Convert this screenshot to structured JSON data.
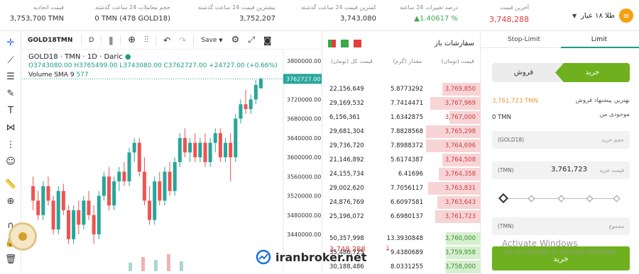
{
  "top_stats": [
    {
      "label": "آخرین قیمت",
      "value": "3,748,288",
      "color": "#e53b3b"
    },
    {
      "label": "درصد تغییرات 24 ساعته",
      "value": "▲1.40617 %",
      "color": "#3aa84b"
    },
    {
      "label": "کمترین قیمت 24 ساعت گذشته",
      "value": "3,743,080",
      "color": "#333333"
    },
    {
      "label": "بیشترین قیمت 24 ساعت گذشته",
      "value": "3,752,207",
      "color": "#333333"
    },
    {
      "label": "حجم معاملات 24 ساعت گذشته",
      "value": "0 TMN (478 GOLD18)",
      "color": "#333333"
    },
    {
      "label": "قیمت اتحادیه",
      "value": "3,753,700 TMN",
      "color": "#333333"
    }
  ],
  "pair": {
    "name": "طلا ۱۸ عیار",
    "icon": "gold-bars-icon"
  },
  "chart_header": {
    "symbol": "GOLD18TMN",
    "interval": "D",
    "save": "Save"
  },
  "legend": {
    "line1": "GOLD18 · TMN · 1D · Daric",
    "ohlc": "O3743080.00 H3765499.00 L3743080.00 C3762727.00 +24727.00 (+0.66%)",
    "volume": "Volume SMA 9",
    "volume_value": "577"
  },
  "chart_data": {
    "type": "candlestick",
    "y_ticks": [
      "3800000.00",
      "3760000.00",
      "3720000.00",
      "3680000.00",
      "3640000.00",
      "3600000.00",
      "3560000.00",
      "3520000.00",
      "3480000.00",
      "3440000.00"
    ],
    "ylim": [
      3400000,
      3820000
    ],
    "last_price_label": "3762727.00",
    "last_price": 3762727,
    "candles": [
      [
        3540000,
        3560000,
        3490000,
        3510000
      ],
      [
        3510000,
        3530000,
        3470000,
        3480000
      ],
      [
        3480000,
        3550000,
        3470000,
        3540000
      ],
      [
        3540000,
        3560000,
        3500000,
        3510000
      ],
      [
        3510000,
        3520000,
        3440000,
        3450000
      ],
      [
        3450000,
        3540000,
        3440000,
        3530000
      ],
      [
        3530000,
        3545000,
        3480000,
        3490000
      ],
      [
        3490000,
        3500000,
        3420000,
        3430000
      ],
      [
        3430000,
        3500000,
        3420000,
        3490000
      ],
      [
        3490000,
        3510000,
        3440000,
        3460000
      ],
      [
        3460000,
        3520000,
        3450000,
        3510000
      ],
      [
        3510000,
        3530000,
        3470000,
        3480000
      ],
      [
        3480000,
        3500000,
        3420000,
        3440000
      ],
      [
        3440000,
        3530000,
        3430000,
        3520000
      ],
      [
        3520000,
        3570000,
        3510000,
        3560000
      ],
      [
        3560000,
        3580000,
        3490000,
        3500000
      ],
      [
        3500000,
        3560000,
        3490000,
        3550000
      ],
      [
        3550000,
        3580000,
        3530000,
        3570000
      ],
      [
        3570000,
        3590000,
        3540000,
        3550000
      ],
      [
        3550000,
        3620000,
        3540000,
        3610000
      ],
      [
        3610000,
        3640000,
        3590000,
        3630000
      ],
      [
        3630000,
        3640000,
        3560000,
        3570000
      ],
      [
        3570000,
        3600000,
        3500000,
        3510000
      ],
      [
        3510000,
        3540000,
        3460000,
        3470000
      ],
      [
        3470000,
        3560000,
        3460000,
        3550000
      ],
      [
        3550000,
        3570000,
        3500000,
        3510000
      ],
      [
        3510000,
        3580000,
        3500000,
        3570000
      ],
      [
        3570000,
        3590000,
        3520000,
        3530000
      ],
      [
        3530000,
        3600000,
        3520000,
        3590000
      ],
      [
        3590000,
        3650000,
        3580000,
        3640000
      ],
      [
        3640000,
        3660000,
        3600000,
        3610000
      ],
      [
        3610000,
        3640000,
        3590000,
        3630000
      ],
      [
        3630000,
        3650000,
        3590000,
        3600000
      ],
      [
        3600000,
        3640000,
        3590000,
        3630000
      ],
      [
        3630000,
        3650000,
        3580000,
        3590000
      ],
      [
        3590000,
        3640000,
        3580000,
        3630000
      ],
      [
        3630000,
        3660000,
        3610000,
        3650000
      ],
      [
        3650000,
        3660000,
        3590000,
        3600000
      ],
      [
        3600000,
        3640000,
        3590000,
        3630000
      ],
      [
        3630000,
        3650000,
        3550000,
        3600000
      ],
      [
        3600000,
        3690000,
        3590000,
        3680000
      ],
      [
        3680000,
        3720000,
        3670000,
        3710000
      ],
      [
        3710000,
        3740000,
        3690000,
        3700000
      ],
      [
        3700000,
        3730000,
        3690000,
        3720000
      ],
      [
        3720000,
        3760000,
        3710000,
        3750000
      ],
      [
        3743080,
        3765499,
        3743080,
        3762727
      ]
    ]
  },
  "order_book": {
    "title": "سفارشات باز",
    "headers": {
      "price": "قیمت (تومان)",
      "amount": "مقدار (گرم)",
      "total": "قیمت کل (تومان)"
    },
    "asks": [
      {
        "price": "3,769,850",
        "amount": "5.8773292",
        "total": "22,156,649",
        "depth": 0.55
      },
      {
        "price": "3,767,969",
        "amount": "7.7414471",
        "total": "29,169,532",
        "depth": 0.72
      },
      {
        "price": "3,767,000",
        "amount": "1.6342875",
        "total": "6,156,361",
        "depth": 0.45
      },
      {
        "price": "3,765,298",
        "amount": "7.8828568",
        "total": "29,681,304",
        "depth": 0.78
      },
      {
        "price": "3,764,696",
        "amount": "7.8988372",
        "total": "29,736,720",
        "depth": 0.78
      },
      {
        "price": "3,764,508",
        "amount": "5.6174387",
        "total": "21,146,892",
        "depth": 0.55
      },
      {
        "price": "3,764,358",
        "amount": "6.41696",
        "total": "24,155,734",
        "depth": 0.6
      },
      {
        "price": "3,763,831",
        "amount": "7.7056117",
        "total": "29,002,620",
        "depth": 0.75
      },
      {
        "price": "3,763,643",
        "amount": "6.6097581",
        "total": "24,876,769",
        "depth": 0.62
      },
      {
        "price": "3,761,723",
        "amount": "6.6980137",
        "total": "25,196,072",
        "depth": 0.65
      }
    ],
    "last_price": "3,748,288",
    "bids": [
      {
        "price": "3,760,000",
        "amount": "13.3930848",
        "total": "50,357,998",
        "depth": 0.5
      },
      {
        "price": "3,759,958",
        "amount": "9.4380689",
        "total": "35,486,725",
        "depth": 0.5
      },
      {
        "price": "3,758,000",
        "amount": "8.0331255",
        "total": "30,188,486",
        "depth": 0.5
      }
    ]
  },
  "trade_form": {
    "tabs": [
      "Limit",
      "Stop-Limit"
    ],
    "active_tab": "Limit",
    "buy": "خرید",
    "sell": "فروش",
    "best_offer_label": "بهترین پیشنهاد فروش",
    "best_offer_value": "3,761,723 TMN",
    "balance_label": "موجودی من",
    "balance_value": "0 TMN",
    "volume_placeholder": "حجم خرید",
    "volume_unit": "(GOLD18)",
    "price_placeholder": "قیمت خرید",
    "price_unit": "(TMN)",
    "price_value": "3,761,723",
    "total_placeholder": "مجموع",
    "total_unit": "(TMN)",
    "submit": "خرید"
  },
  "watermark": "iranbroker.net",
  "windows_notice": {
    "title": "Activate Windows",
    "subtitle": "Go to Settings to activate Windows."
  },
  "colors": {
    "up": "#26a69a",
    "down": "#ef5350",
    "buy": "#6fb01f",
    "ask_bg": "#f7d4d6",
    "bid_bg": "#d6efcf",
    "accent": "#1d9d84"
  }
}
